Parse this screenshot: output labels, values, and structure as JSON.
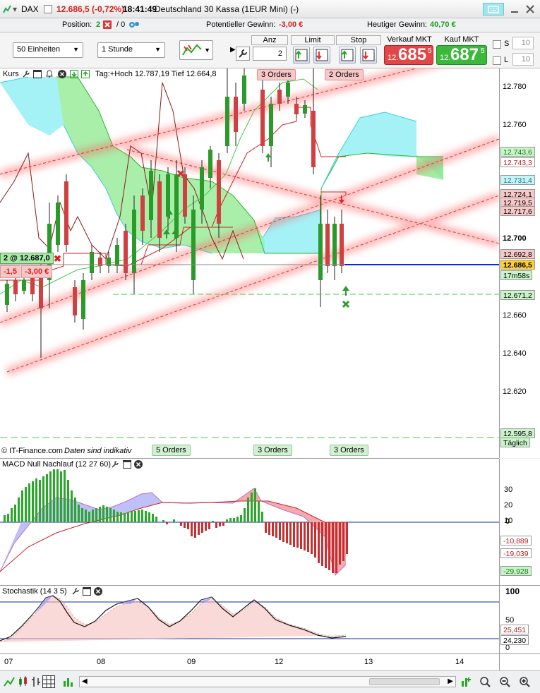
{
  "header": {
    "symbol": "DAX",
    "price_change": "12.686,5 (-0,72%)",
    "time": "18:41:49",
    "instrument": "Deutschland 30 Kassa (1EUR Mini) (-)"
  },
  "position_bar": {
    "position_label": "Position:",
    "position_value": "2",
    "position_zero": "/ 0",
    "potential_label": "Potentieller Gewinn:",
    "potential_value": "-3,00 €",
    "today_label": "Heutiger Gewinn:",
    "today_value": "40,70 €"
  },
  "toolbar": {
    "units_select": "50 Einheiten",
    "interval_select": "1 Stunde",
    "anz_label": "Anz",
    "anz_value": "2",
    "limit_label": "Limit",
    "stop_label": "Stop",
    "sell_label": "Verkauf MKT",
    "sell_small": "12.",
    "sell_big": "685",
    "sell_sup": "5",
    "buy_label": "Kauf MKT",
    "buy_small": "12.",
    "buy_big": "687",
    "buy_sup": "5",
    "s_label": "S",
    "s_value": "10",
    "l_label": "L",
    "l_value": "10"
  },
  "main_chart": {
    "panel_title": "Kurs",
    "info_text": "Tag:+Hoch 12.787,19 Tief 12.664,8",
    "position_tag": "2 @ 12.687,0",
    "pnl_points": "-1,5",
    "pnl_money": "-3,00 €",
    "copyright": "© IT-Finance.com",
    "disclaimer": "Daten sind indikativ",
    "orders_top": [
      "3 Orders",
      "2 Orders"
    ],
    "orders_bottom": [
      "5 Orders",
      "3 Orders",
      "3 Orders"
    ],
    "y_ticks": [
      "12.780",
      "12.760",
      "12.700",
      "12.660",
      "12.640",
      "12.620"
    ],
    "price_labels": [
      "12.743,6",
      "12.743,3",
      "12.731,4",
      "12.724,1",
      "12.719,5",
      "12.717,6",
      "12.692,8",
      "12.686,5",
      "17m58s",
      "12.671,2"
    ],
    "daily_label": "12.595,8",
    "daily_text": "Täglich",
    "colors": {
      "kumo_green": "#7fe07f",
      "kumo_cyan": "#7fe8f0",
      "up_candle": "#2a9a2a",
      "down_candle": "#d04040",
      "last_price": "#1428c8"
    }
  },
  "macd": {
    "title": "MACD Null Nachlauf (12 27 60)",
    "y_ticks": [
      "30",
      "20",
      "10",
      "0"
    ],
    "value_labels": [
      "-10,889",
      "-19,039",
      "-29,928"
    ]
  },
  "stoch": {
    "title": "Stochastik (14 3 5)",
    "y_ticks": [
      "100",
      "50",
      "0"
    ],
    "value_labels": [
      "25,451",
      "24,230"
    ]
  },
  "x_axis": [
    "07",
    "08",
    "09",
    "12",
    "13",
    "14"
  ]
}
